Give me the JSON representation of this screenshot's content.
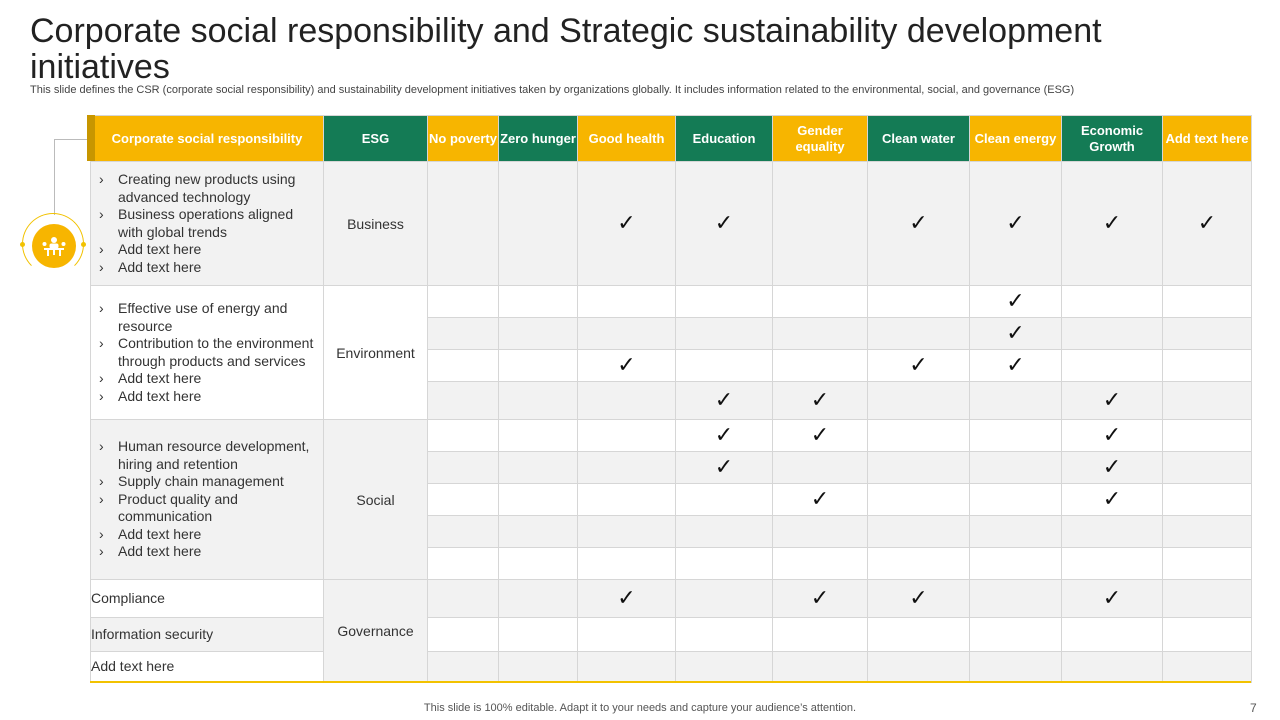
{
  "title": "Corporate social responsibility and Strategic sustainability development initiatives",
  "subtitle": "This slide defines the CSR (corporate social responsibility) and sustainability development initiatives taken by organizations globally. It includes information related to the environmental, social, and governance (ESG)",
  "footer": "This slide is 100% editable. Adapt it to your needs and capture your audience’s attention.",
  "page_number": "7",
  "check_symbol": "✓",
  "colors": {
    "yellow": "#f7b500",
    "green": "#147b55",
    "shade": "#f2f2f2"
  },
  "table": {
    "headers": [
      "Corporate social responsibility",
      "ESG",
      "No poverty",
      "Zero hunger",
      "Good health",
      "Education",
      "Gender equality",
      "Clean water",
      "Clean energy",
      "Economic Growth",
      "Add text here"
    ],
    "business": {
      "label": "Business",
      "items": [
        "Creating new products using advanced technology",
        "Business operations aligned with global trends",
        "Add text here",
        "Add text here"
      ]
    },
    "environment": {
      "label": "Environment",
      "items": [
        "Effective use of energy and resource",
        "Contribution to the environment through products and services",
        "Add text here",
        "Add text here"
      ]
    },
    "social": {
      "label": "Social",
      "items": [
        "Human resource development, hiring and retention",
        "Supply chain management",
        "Product quality and communication",
        "Add text here",
        "Add text here"
      ]
    },
    "governance": {
      "label": "Governance",
      "items": [
        "Compliance",
        "Information security",
        "Add text here"
      ]
    }
  }
}
